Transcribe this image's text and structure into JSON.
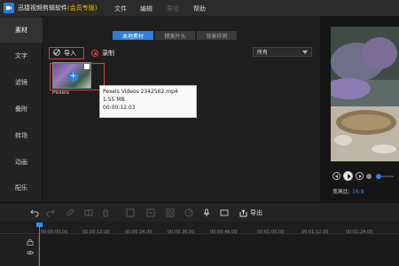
{
  "app": {
    "title_main": "迅捷视频剪辑软件",
    "title_badge": "(会员专版)",
    "menu": [
      {
        "label": "文件",
        "enabled": true
      },
      {
        "label": "编辑",
        "enabled": true
      },
      {
        "label": "导出",
        "enabled": false
      },
      {
        "label": "帮助",
        "enabled": true
      }
    ]
  },
  "sidebar": {
    "items": [
      {
        "label": "素材",
        "active": true
      },
      {
        "label": "文字",
        "active": false
      },
      {
        "label": "滤镜",
        "active": false
      },
      {
        "label": "叠附",
        "active": false
      },
      {
        "label": "转场",
        "active": false
      },
      {
        "label": "动画",
        "active": false
      },
      {
        "label": "配乐",
        "active": false
      }
    ]
  },
  "library": {
    "tabs": [
      {
        "label": "本地素材",
        "active": true
      },
      {
        "label": "精美片头",
        "active": false
      },
      {
        "label": "背景样例",
        "active": false
      }
    ],
    "import_label": "导入",
    "record_label": "录制",
    "filter_value": "所有",
    "media": [
      {
        "label": "Pexels"
      }
    ],
    "tooltip": {
      "filename": "Pexels Videos 2342562.mp4",
      "size": "1.55 MB",
      "duration": "00:00:12.03"
    }
  },
  "preview": {
    "aspect_label": "宽高比:",
    "aspect_value": "16:9",
    "seek_position": 0
  },
  "toolbar": {
    "export_label": "导出"
  },
  "timeline": {
    "ticks": [
      "00:00:00.00",
      "00:00:12.00",
      "00:00:24.00",
      "00:00:36.00",
      "00:00:48.00",
      "00:01:00.00",
      "00:01:12.00",
      "00:01:24.00"
    ]
  },
  "colors": {
    "accent": "#2f7fd6",
    "highlight_red": "#e23d3d",
    "vip_yellow": "#f0c000"
  }
}
